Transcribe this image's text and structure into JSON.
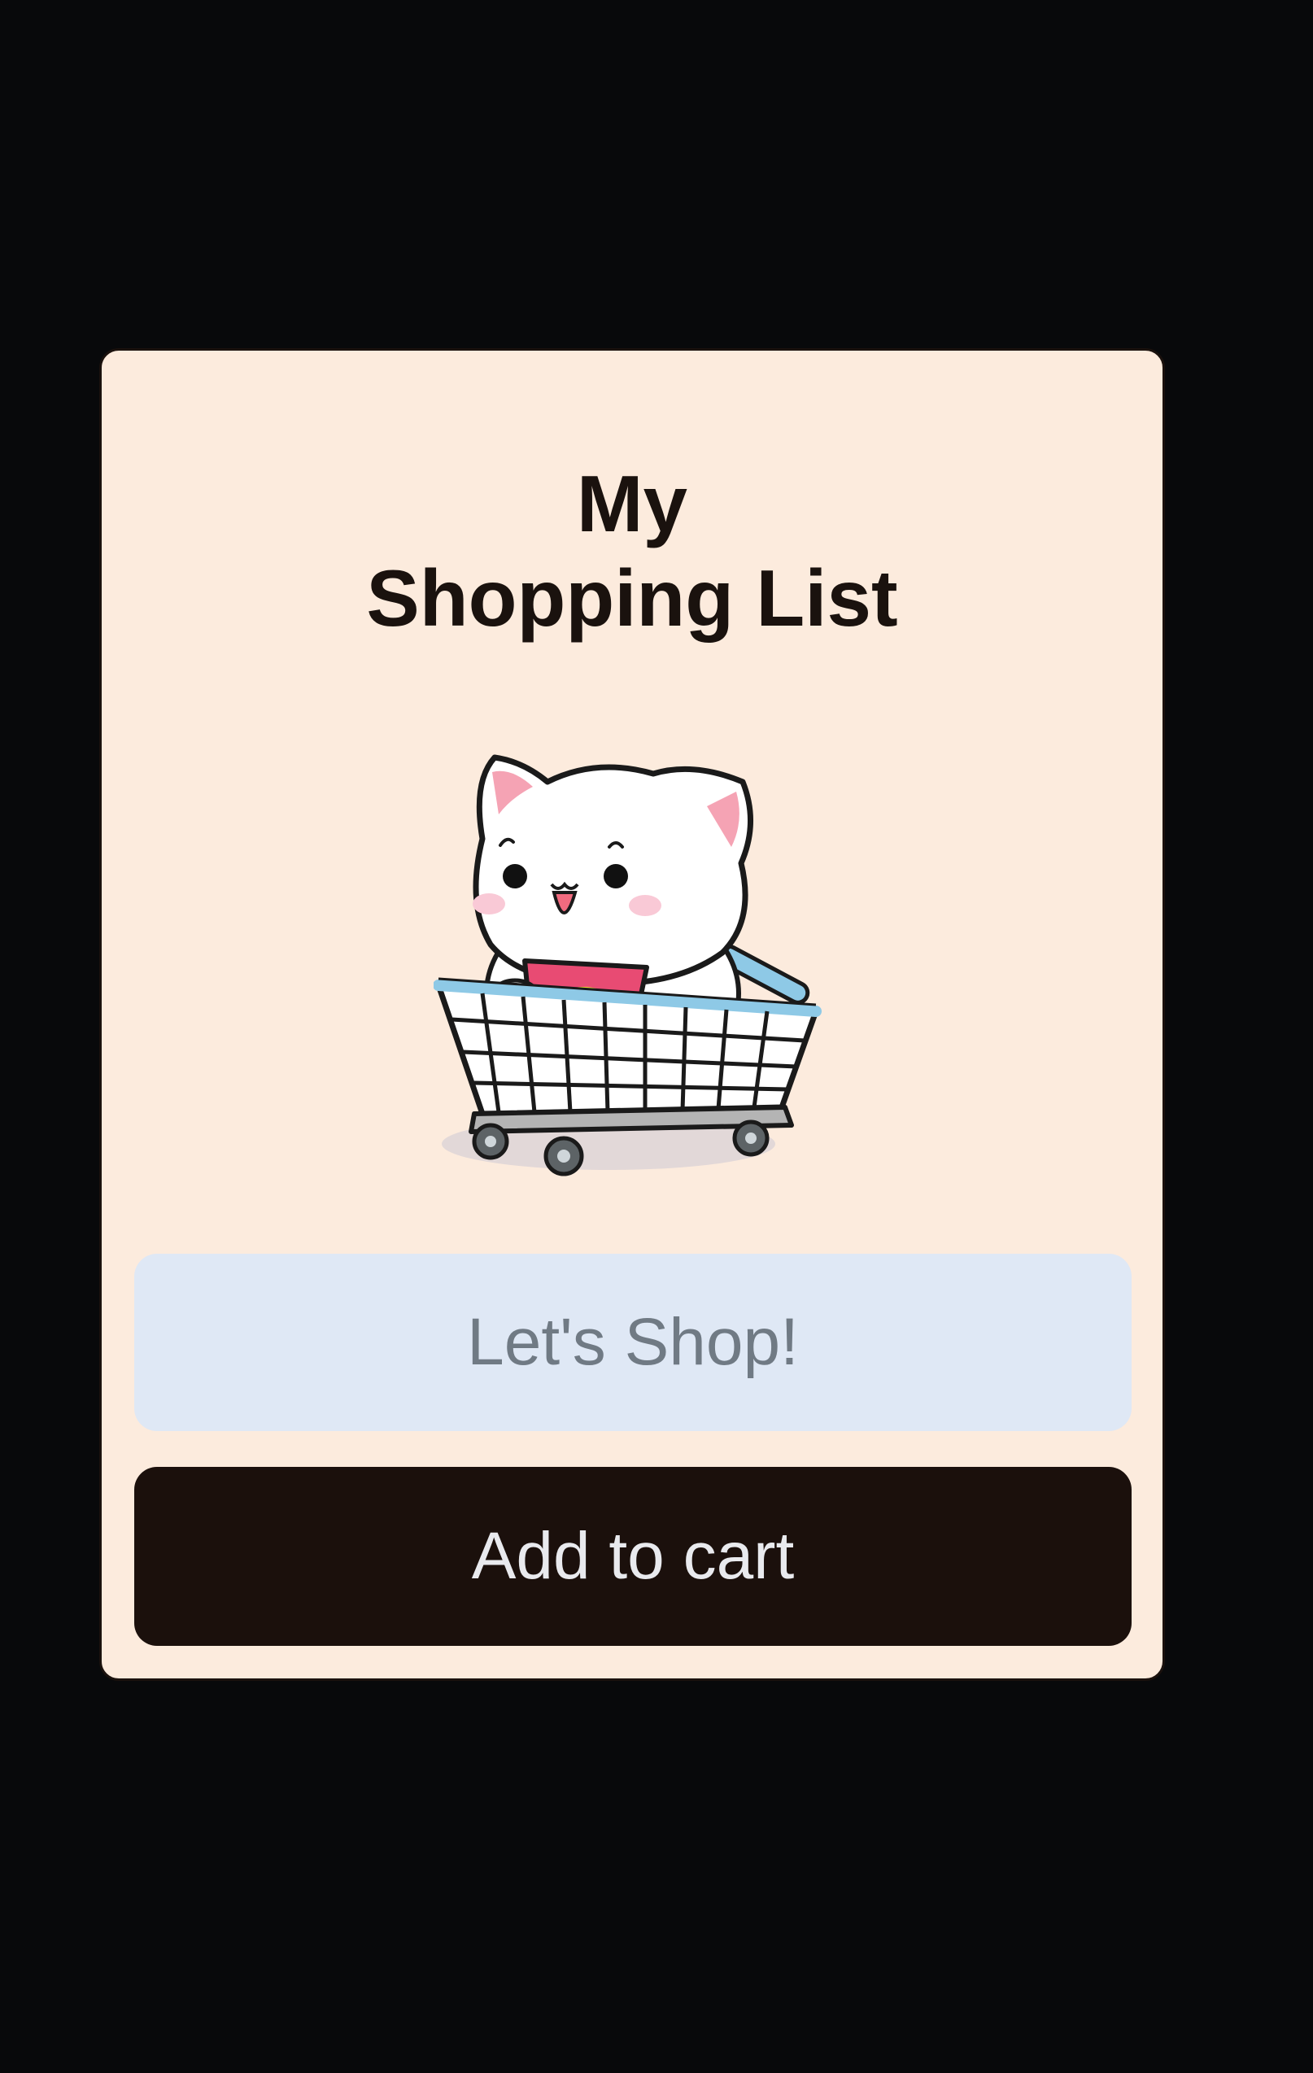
{
  "header": {
    "title_line1": "My",
    "title_line2": "Shopping List"
  },
  "mascot": {
    "icon": "cat-in-shopping-cart-icon"
  },
  "form": {
    "input_placeholder": "Let's Shop!",
    "input_value": "",
    "add_button_label": "Add to cart"
  },
  "colors": {
    "page_background": "#08090b",
    "card_background": "#fcebdd",
    "input_background": "#dfe8f5",
    "button_background": "#1b100c",
    "button_text": "#e9eaee"
  }
}
